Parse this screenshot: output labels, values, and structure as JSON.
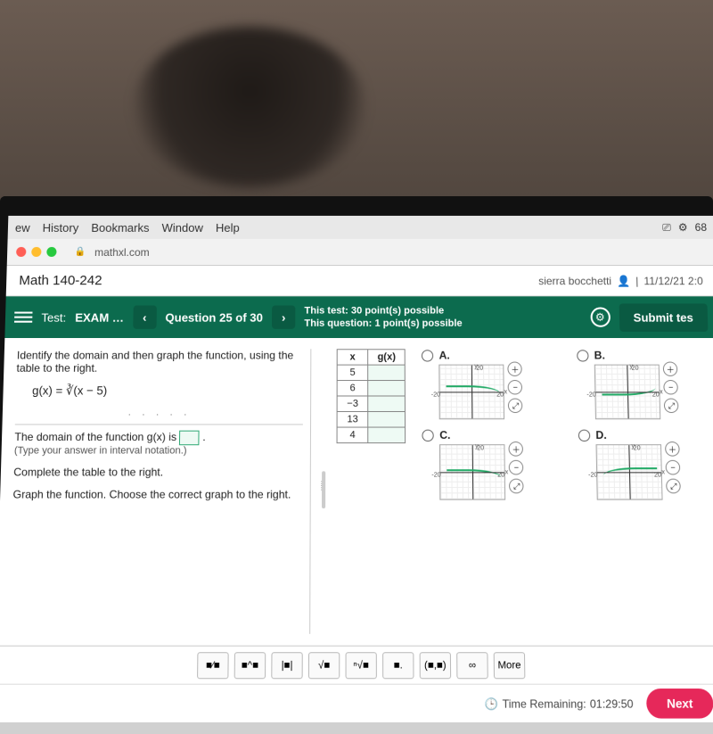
{
  "mac_menu": {
    "items": [
      "ew",
      "History",
      "Bookmarks",
      "Window",
      "Help"
    ],
    "battery": "68"
  },
  "browser": {
    "url": "mathxl.com"
  },
  "course": {
    "title": "Math 140-242",
    "user": "sierra bocchetti",
    "datetime": "11/12/21 2:0"
  },
  "test_bar": {
    "label": "Test:",
    "name": "EXAM …",
    "question_of": "Question 25 of 30",
    "info_line1": "This test: 30 point(s) possible",
    "info_line2": "This question: 1 point(s) possible",
    "submit": "Submit tes"
  },
  "question": {
    "prompt": "Identify the domain and then graph the function, using the table to the right.",
    "formula": "g(x) = ∛(x − 5)",
    "domain_line_pre": "The domain of the function g(x) is ",
    "domain_line_post": ".",
    "hint": "(Type your answer in interval notation.)",
    "complete": "Complete the table to the right.",
    "graph_prompt": "Graph the function. Choose the correct graph to the right."
  },
  "table": {
    "headers": [
      "x",
      "g(x)"
    ],
    "xvals": [
      "5",
      "6",
      "−3",
      "13",
      "4"
    ]
  },
  "choices": {
    "labels": [
      "A.",
      "B.",
      "C.",
      "D."
    ]
  },
  "chart_data": [
    {
      "type": "line",
      "title": "A",
      "xlabel": "x",
      "ylabel": "y",
      "xlim": [
        -20,
        20
      ],
      "ylim": [
        -20,
        20
      ],
      "series": [
        {
          "name": "g",
          "values": [
            [
              -20,
              -1
            ],
            [
              0,
              1
            ],
            [
              20,
              2
            ]
          ]
        }
      ]
    },
    {
      "type": "line",
      "title": "B",
      "xlabel": "x",
      "ylabel": "y",
      "xlim": [
        -20,
        20
      ],
      "ylim": [
        -20,
        20
      ],
      "series": [
        {
          "name": "g",
          "values": [
            [
              -20,
              2
            ],
            [
              0,
              1
            ],
            [
              20,
              -1
            ]
          ]
        }
      ]
    },
    {
      "type": "line",
      "title": "C",
      "xlabel": "x",
      "ylabel": "y",
      "xlim": [
        -20,
        20
      ],
      "ylim": [
        -20,
        20
      ],
      "series": [
        {
          "name": "g",
          "values": [
            [
              -20,
              -2
            ],
            [
              0,
              0
            ],
            [
              20,
              2
            ]
          ]
        }
      ]
    },
    {
      "type": "line",
      "title": "D",
      "xlabel": "x",
      "ylabel": "y",
      "xlim": [
        -20,
        20
      ],
      "ylim": [
        -20,
        20
      ],
      "series": [
        {
          "name": "g",
          "values": [
            [
              -20,
              2
            ],
            [
              0,
              0
            ],
            [
              20,
              -2
            ]
          ]
        }
      ]
    }
  ],
  "math_buttons": [
    "■⁄■",
    "■^■",
    "|■|",
    "√■",
    "ⁿ√■",
    "■.",
    "(■,■)",
    "∞",
    "More"
  ],
  "footer": {
    "time_label": "Time Remaining:",
    "time": "01:29:50",
    "next": "Next"
  }
}
